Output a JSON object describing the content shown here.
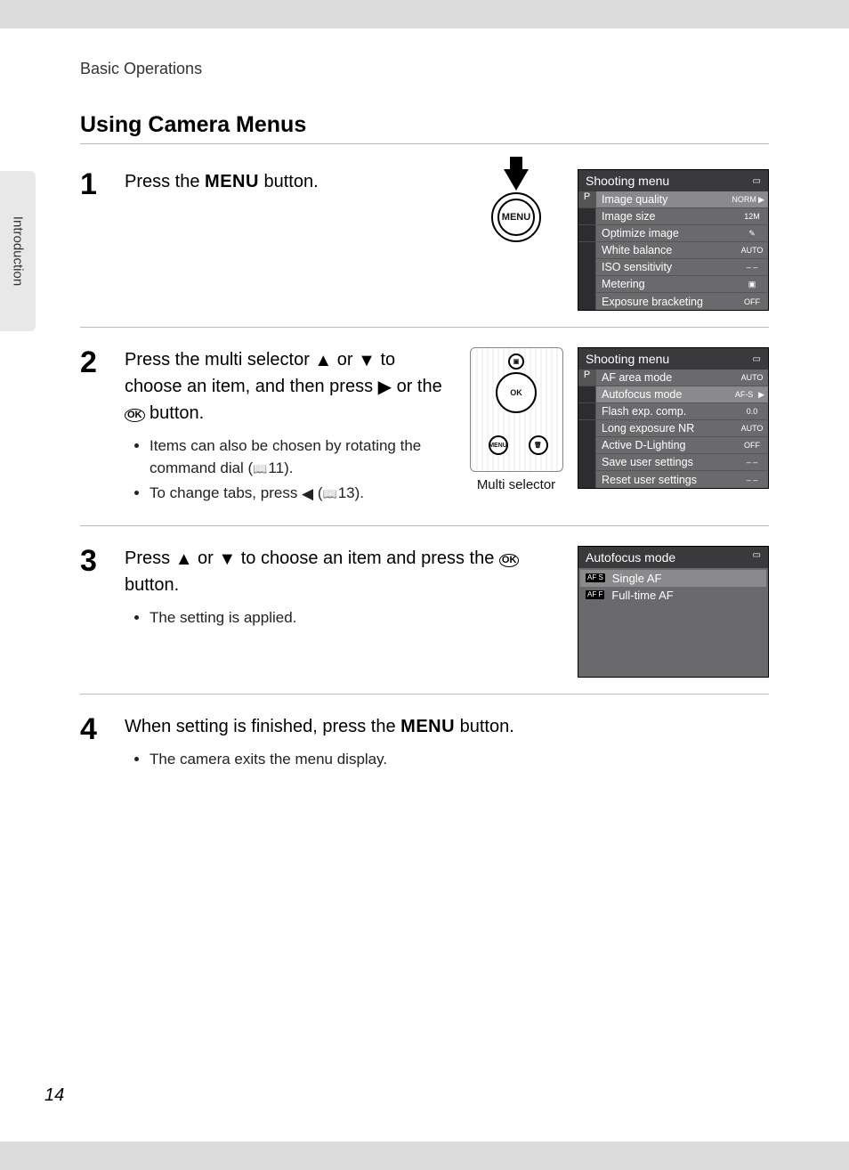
{
  "breadcrumb": "Basic Operations",
  "side_tab": "Introduction",
  "title": "Using Camera Menus",
  "page_number": "14",
  "glyphs": {
    "up": "▲",
    "down": "▼",
    "right": "▶",
    "left": "◀",
    "ok": "OK",
    "menu": "MENU"
  },
  "steps": [
    {
      "num": "1",
      "lead_parts": [
        "Press the ",
        " button."
      ]
    },
    {
      "num": "2",
      "lead_parts": [
        "Press the multi selector ",
        " or ",
        " to choose an item, and then press ",
        " or the ",
        " button."
      ],
      "notes": [
        {
          "pre": "Items can also be chosen by rotating the command dial (",
          "ref": "11",
          "post": ")."
        },
        {
          "pre": "To change tabs, press ",
          "glyph": "left",
          "post2_pre": " (",
          "ref": "13",
          "post": ")."
        }
      ],
      "caption": "Multi selector"
    },
    {
      "num": "3",
      "lead_parts": [
        "Press ",
        " or ",
        " to choose an item and press the ",
        " button."
      ],
      "note_simple": "The setting is applied."
    },
    {
      "num": "4",
      "lead_parts": [
        "When setting is finished, press the ",
        " button."
      ],
      "note_simple": "The camera exits the menu display."
    }
  ],
  "shot1": {
    "title": "Shooting menu",
    "tab_active": "P",
    "rows": [
      {
        "label": "Image quality",
        "val": "NORM",
        "hl": true,
        "arrow": true
      },
      {
        "label": "Image size",
        "val": "12M"
      },
      {
        "label": "Optimize image",
        "val": "✎"
      },
      {
        "label": "White balance",
        "val": "AUTO"
      },
      {
        "label": "ISO sensitivity",
        "val": "– –"
      },
      {
        "label": "Metering",
        "val": "▣"
      },
      {
        "label": "Exposure bracketing",
        "val": "OFF"
      }
    ]
  },
  "shot2": {
    "title": "Shooting menu",
    "tab_active": "P",
    "rows": [
      {
        "label": "AF area mode",
        "val": "AUTO"
      },
      {
        "label": "Autofocus mode",
        "val": "AF-S",
        "hl": true,
        "arrow": true
      },
      {
        "label": "Flash exp. comp.",
        "val": "0.0"
      },
      {
        "label": "Long exposure NR",
        "val": "AUTO"
      },
      {
        "label": "Active D-Lighting",
        "val": "OFF"
      },
      {
        "label": "Save user settings",
        "val": "– –"
      },
      {
        "label": "Reset user settings",
        "val": "– –"
      }
    ]
  },
  "shot3": {
    "title": "Autofocus mode",
    "rows": [
      {
        "icon": "AF S",
        "label": "Single AF",
        "sel": true
      },
      {
        "icon": "AF F",
        "label": "Full-time AF"
      }
    ]
  }
}
